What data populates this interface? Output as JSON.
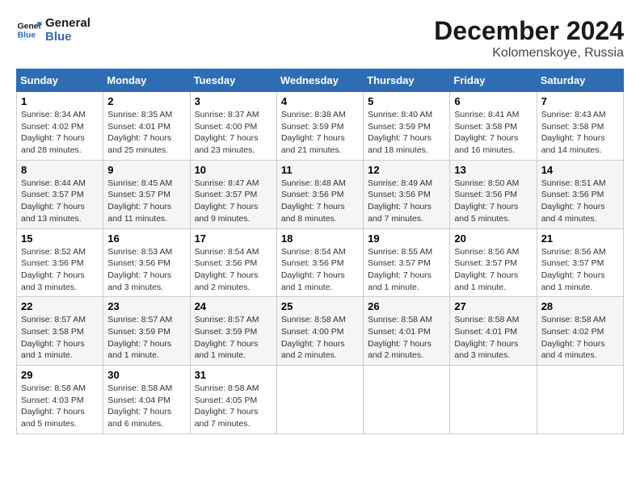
{
  "header": {
    "logo_line1": "General",
    "logo_line2": "Blue",
    "month": "December 2024",
    "location": "Kolomenskoye, Russia"
  },
  "weekdays": [
    "Sunday",
    "Monday",
    "Tuesday",
    "Wednesday",
    "Thursday",
    "Friday",
    "Saturday"
  ],
  "weeks": [
    [
      {
        "day": "1",
        "info": "Sunrise: 8:34 AM\nSunset: 4:02 PM\nDaylight: 7 hours and 28 minutes."
      },
      {
        "day": "2",
        "info": "Sunrise: 8:35 AM\nSunset: 4:01 PM\nDaylight: 7 hours and 25 minutes."
      },
      {
        "day": "3",
        "info": "Sunrise: 8:37 AM\nSunset: 4:00 PM\nDaylight: 7 hours and 23 minutes."
      },
      {
        "day": "4",
        "info": "Sunrise: 8:38 AM\nSunset: 3:59 PM\nDaylight: 7 hours and 21 minutes."
      },
      {
        "day": "5",
        "info": "Sunrise: 8:40 AM\nSunset: 3:59 PM\nDaylight: 7 hours and 18 minutes."
      },
      {
        "day": "6",
        "info": "Sunrise: 8:41 AM\nSunset: 3:58 PM\nDaylight: 7 hours and 16 minutes."
      },
      {
        "day": "7",
        "info": "Sunrise: 8:43 AM\nSunset: 3:58 PM\nDaylight: 7 hours and 14 minutes."
      }
    ],
    [
      {
        "day": "8",
        "info": "Sunrise: 8:44 AM\nSunset: 3:57 PM\nDaylight: 7 hours and 13 minutes."
      },
      {
        "day": "9",
        "info": "Sunrise: 8:45 AM\nSunset: 3:57 PM\nDaylight: 7 hours and 11 minutes."
      },
      {
        "day": "10",
        "info": "Sunrise: 8:47 AM\nSunset: 3:57 PM\nDaylight: 7 hours and 9 minutes."
      },
      {
        "day": "11",
        "info": "Sunrise: 8:48 AM\nSunset: 3:56 PM\nDaylight: 7 hours and 8 minutes."
      },
      {
        "day": "12",
        "info": "Sunrise: 8:49 AM\nSunset: 3:56 PM\nDaylight: 7 hours and 7 minutes."
      },
      {
        "day": "13",
        "info": "Sunrise: 8:50 AM\nSunset: 3:56 PM\nDaylight: 7 hours and 5 minutes."
      },
      {
        "day": "14",
        "info": "Sunrise: 8:51 AM\nSunset: 3:56 PM\nDaylight: 7 hours and 4 minutes."
      }
    ],
    [
      {
        "day": "15",
        "info": "Sunrise: 8:52 AM\nSunset: 3:56 PM\nDaylight: 7 hours and 3 minutes."
      },
      {
        "day": "16",
        "info": "Sunrise: 8:53 AM\nSunset: 3:56 PM\nDaylight: 7 hours and 3 minutes."
      },
      {
        "day": "17",
        "info": "Sunrise: 8:54 AM\nSunset: 3:56 PM\nDaylight: 7 hours and 2 minutes."
      },
      {
        "day": "18",
        "info": "Sunrise: 8:54 AM\nSunset: 3:56 PM\nDaylight: 7 hours and 1 minute."
      },
      {
        "day": "19",
        "info": "Sunrise: 8:55 AM\nSunset: 3:57 PM\nDaylight: 7 hours and 1 minute."
      },
      {
        "day": "20",
        "info": "Sunrise: 8:56 AM\nSunset: 3:57 PM\nDaylight: 7 hours and 1 minute."
      },
      {
        "day": "21",
        "info": "Sunrise: 8:56 AM\nSunset: 3:57 PM\nDaylight: 7 hours and 1 minute."
      }
    ],
    [
      {
        "day": "22",
        "info": "Sunrise: 8:57 AM\nSunset: 3:58 PM\nDaylight: 7 hours and 1 minute."
      },
      {
        "day": "23",
        "info": "Sunrise: 8:57 AM\nSunset: 3:59 PM\nDaylight: 7 hours and 1 minute."
      },
      {
        "day": "24",
        "info": "Sunrise: 8:57 AM\nSunset: 3:59 PM\nDaylight: 7 hours and 1 minute."
      },
      {
        "day": "25",
        "info": "Sunrise: 8:58 AM\nSunset: 4:00 PM\nDaylight: 7 hours and 2 minutes."
      },
      {
        "day": "26",
        "info": "Sunrise: 8:58 AM\nSunset: 4:01 PM\nDaylight: 7 hours and 2 minutes."
      },
      {
        "day": "27",
        "info": "Sunrise: 8:58 AM\nSunset: 4:01 PM\nDaylight: 7 hours and 3 minutes."
      },
      {
        "day": "28",
        "info": "Sunrise: 8:58 AM\nSunset: 4:02 PM\nDaylight: 7 hours and 4 minutes."
      }
    ],
    [
      {
        "day": "29",
        "info": "Sunrise: 8:58 AM\nSunset: 4:03 PM\nDaylight: 7 hours and 5 minutes."
      },
      {
        "day": "30",
        "info": "Sunrise: 8:58 AM\nSunset: 4:04 PM\nDaylight: 7 hours and 6 minutes."
      },
      {
        "day": "31",
        "info": "Sunrise: 8:58 AM\nSunset: 4:05 PM\nDaylight: 7 hours and 7 minutes."
      },
      null,
      null,
      null,
      null
    ]
  ]
}
